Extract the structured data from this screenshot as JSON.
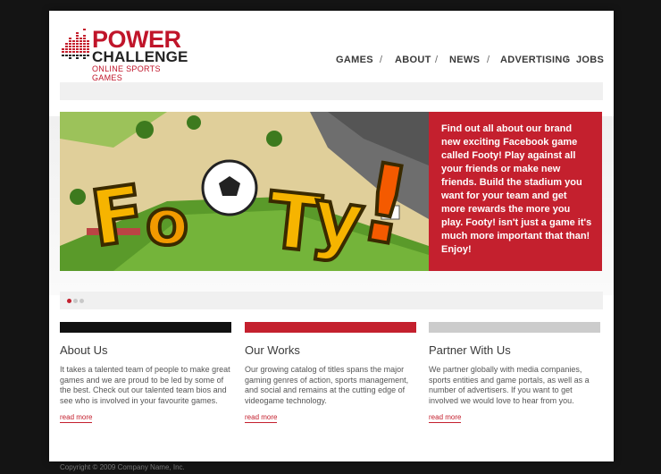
{
  "brand": {
    "line1": "POWER",
    "line2": "CHALLENGE",
    "tagline": "ONLINE SPORTS GAMES"
  },
  "nav": {
    "items": [
      "GAMES",
      "ABOUT",
      "NEWS",
      "ADVERTISING",
      "JOBS"
    ],
    "separator": "/"
  },
  "hero": {
    "image_word": "FooTy!",
    "text": "Find out all about our brand new exciting Facebook game called Footy! Play against all your friends or make new friends. Build the stadium you want for your team and get more rewards the more you play. Footy! isn't just a game it's much more important that than! Enjoy!"
  },
  "slider": {
    "total": 3,
    "active": 1
  },
  "columns": [
    {
      "title": "About Us",
      "body": "It takes a talented team of people to make great games and we are proud to be led by some of the best. Check out our talented team bios and see who is involved in your favourite games.",
      "link": "read more",
      "stripe_color": "#111111"
    },
    {
      "title": "Our Works",
      "body": "Our growing catalog of titles spans the major gaming genres of action, sports management, and social and remains at the cutting edge of videogame technology.",
      "link": "read more",
      "stripe_color": "#c4202e"
    },
    {
      "title": "Partner With Us",
      "body": "We partner globally with media companies, sports entities and game portals, as well as a number of advertisers. If you want to get involved we would love to hear from you.",
      "link": "read more",
      "stripe_color": "#cccccc"
    }
  ],
  "footer": {
    "copyright": "Copyright © 2009 Company Name, Inc."
  },
  "colors": {
    "accent": "#c4202e",
    "background": "#141414",
    "panel": "#ffffff"
  }
}
